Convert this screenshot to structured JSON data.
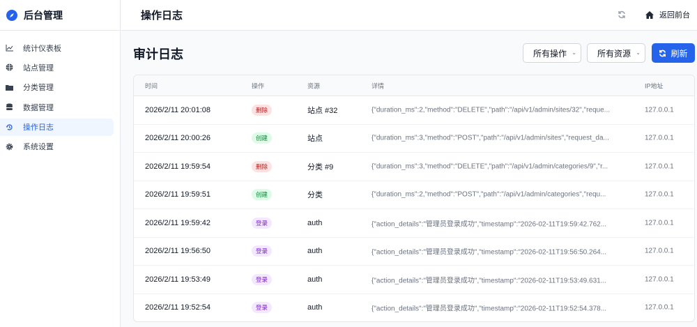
{
  "brand": {
    "title": "后台管理"
  },
  "sidebar": {
    "items": [
      {
        "label": "统计仪表板",
        "icon": "chart-line-icon"
      },
      {
        "label": "站点管理",
        "icon": "globe-icon"
      },
      {
        "label": "分类管理",
        "icon": "folder-icon"
      },
      {
        "label": "数据管理",
        "icon": "database-icon"
      },
      {
        "label": "操作日志",
        "icon": "history-icon",
        "active": true
      },
      {
        "label": "系统设置",
        "icon": "gear-icon"
      }
    ]
  },
  "header": {
    "title": "操作日志",
    "home_label": "返回前台"
  },
  "main": {
    "title": "审计日志",
    "filter_action": "所有操作",
    "filter_resource": "所有资源",
    "refresh_label": "刷新"
  },
  "table": {
    "columns": [
      "时间",
      "操作",
      "资源",
      "详情",
      "IP地址"
    ],
    "rows": [
      {
        "time": "2026/2/11 20:01:08",
        "action": "删除",
        "type": "del",
        "resource": "站点 #32",
        "details": "{\"duration_ms\":2,\"method\":\"DELETE\",\"path\":\"/api/v1/admin/sites/32\",\"reque...",
        "ip": "127.0.0.1"
      },
      {
        "time": "2026/2/11 20:00:26",
        "action": "创建",
        "type": "add",
        "resource": "站点",
        "details": "{\"duration_ms\":3,\"method\":\"POST\",\"path\":\"/api/v1/admin/sites\",\"request_da...",
        "ip": "127.0.0.1"
      },
      {
        "time": "2026/2/11 19:59:54",
        "action": "删除",
        "type": "del",
        "resource": "分类 #9",
        "details": "{\"duration_ms\":3,\"method\":\"DELETE\",\"path\":\"/api/v1/admin/categories/9\",\"r...",
        "ip": "127.0.0.1"
      },
      {
        "time": "2026/2/11 19:59:51",
        "action": "创建",
        "type": "add",
        "resource": "分类",
        "details": "{\"duration_ms\":2,\"method\":\"POST\",\"path\":\"/api/v1/admin/categories\",\"requ...",
        "ip": "127.0.0.1"
      },
      {
        "time": "2026/2/11 19:59:42",
        "action": "登录",
        "type": "login",
        "resource": "auth",
        "details": "{\"action_details\":\"管理员登录成功\",\"timestamp\":\"2026-02-11T19:59:42.762...",
        "ip": "127.0.0.1"
      },
      {
        "time": "2026/2/11 19:56:50",
        "action": "登录",
        "type": "login",
        "resource": "auth",
        "details": "{\"action_details\":\"管理员登录成功\",\"timestamp\":\"2026-02-11T19:56:50.264...",
        "ip": "127.0.0.1"
      },
      {
        "time": "2026/2/11 19:53:49",
        "action": "登录",
        "type": "login",
        "resource": "auth",
        "details": "{\"action_details\":\"管理员登录成功\",\"timestamp\":\"2026-02-11T19:53:49.631...",
        "ip": "127.0.0.1"
      },
      {
        "time": "2026/2/11 19:52:54",
        "action": "登录",
        "type": "login",
        "resource": "auth",
        "details": "{\"action_details\":\"管理员登录成功\",\"timestamp\":\"2026-02-11T19:52:54.378...",
        "ip": "127.0.0.1"
      }
    ]
  },
  "colors": {
    "accent": "#2563eb",
    "delete": "#b91c1c",
    "create": "#15803d",
    "login": "#7e22ce"
  }
}
